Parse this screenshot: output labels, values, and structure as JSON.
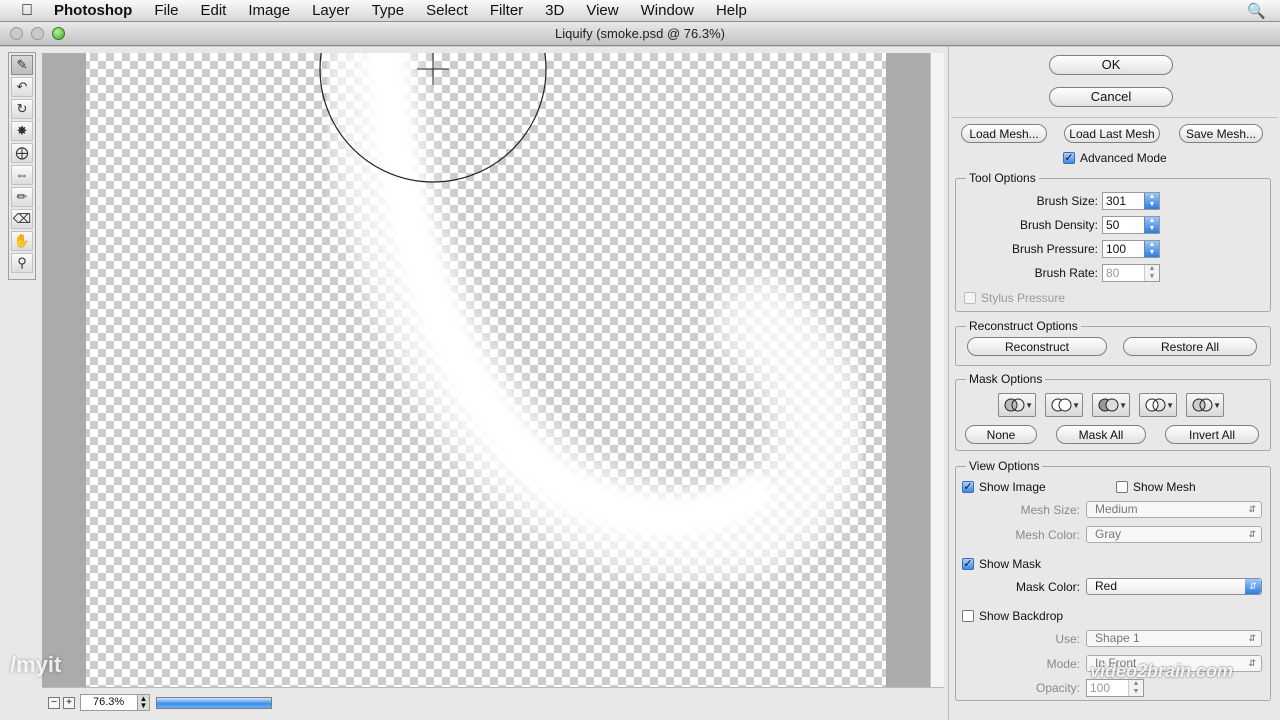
{
  "menubar": {
    "app": "Photoshop",
    "items": [
      "File",
      "Edit",
      "Image",
      "Layer",
      "Type",
      "Select",
      "Filter",
      "3D",
      "View",
      "Window",
      "Help"
    ]
  },
  "window": {
    "title": "Liquify (smoke.psd @ 76.3%)"
  },
  "tools": [
    "forward-warp",
    "reconstruct",
    "twirl",
    "pucker",
    "bloat",
    "push-left",
    "freeze-mask",
    "thaw-mask",
    "hand",
    "zoom"
  ],
  "bottom": {
    "zoom": "76.3%",
    "progress": 1.0
  },
  "watermark": "/myit",
  "watermark2": "video2brain.com",
  "panel": {
    "ok": "OK",
    "cancel": "Cancel",
    "load_mesh": "Load Mesh...",
    "load_last_mesh": "Load Last Mesh",
    "save_mesh": "Save Mesh...",
    "advanced_mode": "Advanced Mode",
    "tool_options": {
      "title": "Tool Options",
      "brush_size_label": "Brush Size:",
      "brush_size": "301",
      "brush_density_label": "Brush Density:",
      "brush_density": "50",
      "brush_pressure_label": "Brush Pressure:",
      "brush_pressure": "100",
      "brush_rate_label": "Brush Rate:",
      "brush_rate": "80",
      "stylus_pressure": "Stylus Pressure"
    },
    "reconstruct_options": {
      "title": "Reconstruct Options",
      "reconstruct": "Reconstruct",
      "restore_all": "Restore All"
    },
    "mask_options": {
      "title": "Mask Options",
      "none": "None",
      "mask_all": "Mask All",
      "invert_all": "Invert All"
    },
    "view_options": {
      "title": "View Options",
      "show_image": "Show Image",
      "show_mesh": "Show Mesh",
      "mesh_size_label": "Mesh Size:",
      "mesh_size": "Medium",
      "mesh_color_label": "Mesh Color:",
      "mesh_color": "Gray",
      "show_mask": "Show Mask",
      "mask_color_label": "Mask Color:",
      "mask_color": "Red",
      "show_backdrop": "Show Backdrop",
      "use_label": "Use:",
      "use": "Shape 1",
      "mode_label": "Mode:",
      "mode": "In Front",
      "opacity_label": "Opacity:",
      "opacity": "100"
    }
  }
}
